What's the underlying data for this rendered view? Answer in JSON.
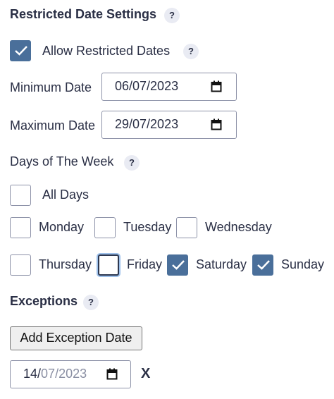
{
  "header": {
    "title": "Restricted Date Settings",
    "help": "?"
  },
  "allow_restricted": {
    "label": "Allow Restricted Dates",
    "checked": true,
    "help": "?"
  },
  "minimum_date": {
    "label": "Minimum Date",
    "value": "06/07/2023"
  },
  "maximum_date": {
    "label": "Maximum Date",
    "value": "29/07/2023"
  },
  "days_of_week": {
    "title": "Days of The Week",
    "help": "?",
    "all_days": {
      "label": "All Days",
      "checked": false
    },
    "days": [
      {
        "label": "Monday",
        "checked": false
      },
      {
        "label": "Tuesday",
        "checked": false
      },
      {
        "label": "Wednesday",
        "checked": false
      },
      {
        "label": "Thursday",
        "checked": false
      },
      {
        "label": "Friday",
        "checked": false,
        "focused": true
      },
      {
        "label": "Saturday",
        "checked": true
      },
      {
        "label": "Sunday",
        "checked": true
      }
    ]
  },
  "exceptions": {
    "title": "Exceptions",
    "help": "?",
    "add_button": "Add Exception Date",
    "date": {
      "day": "14",
      "sep1": "/",
      "month": "07",
      "sep2": "/",
      "year": "2023"
    },
    "remove": "X"
  },
  "colors": {
    "accent": "#4a6f9a",
    "text": "#2a2f45",
    "help_bg": "#e9ebf3"
  },
  "icons": {
    "check": "checkmark-icon",
    "calendar": "calendar-icon",
    "help": "help-icon"
  }
}
